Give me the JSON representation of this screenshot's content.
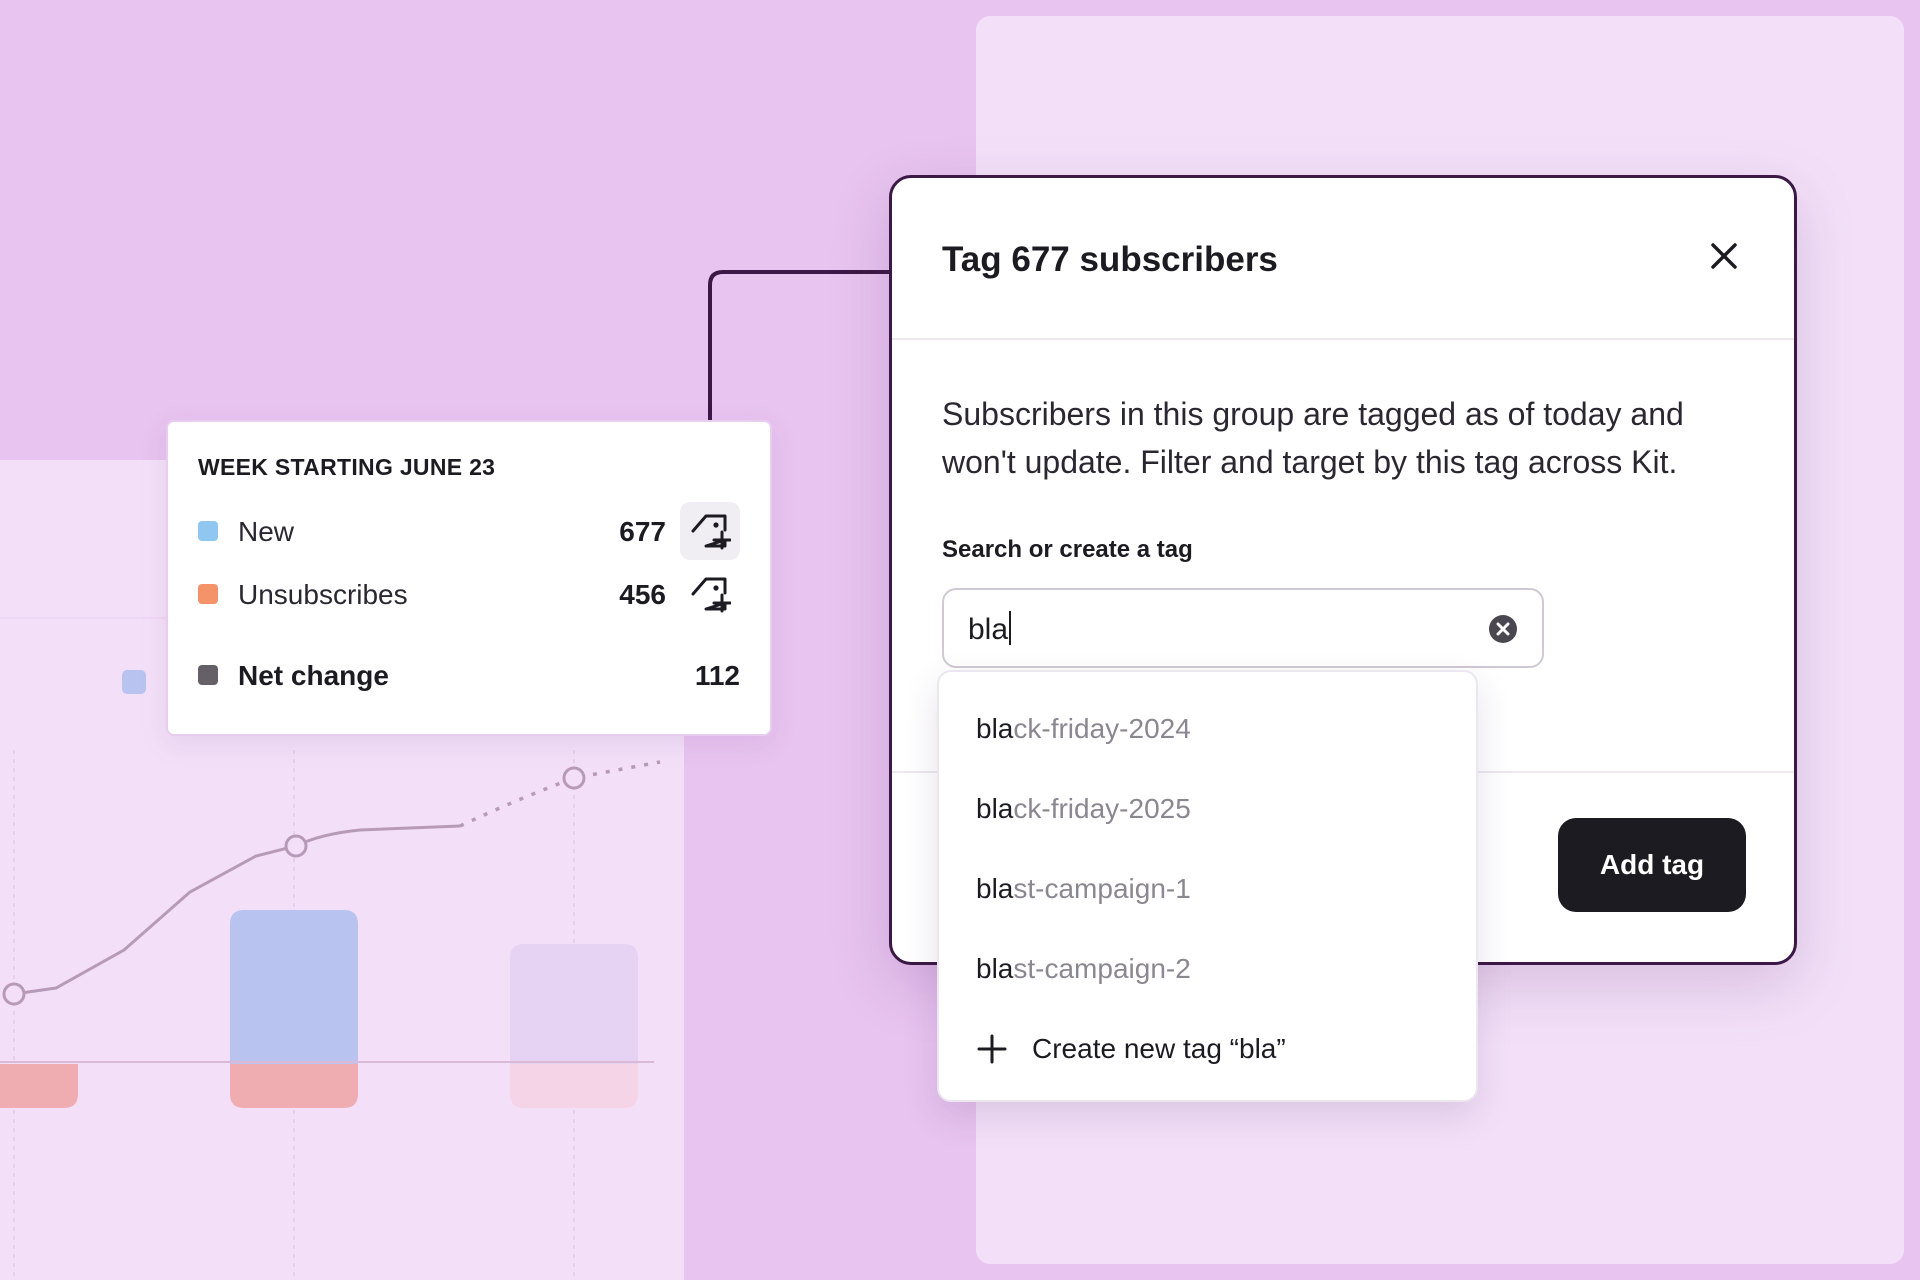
{
  "tooltip": {
    "title": "WEEK STARTING JUNE 23",
    "rows": [
      {
        "label": "New",
        "value": "677",
        "color": "#8fc7f0"
      },
      {
        "label": "Unsubscribes",
        "value": "456",
        "color": "#f4926a"
      },
      {
        "label": "Net change",
        "value": "112",
        "color": "#656068"
      }
    ]
  },
  "modal": {
    "title": "Tag 677 subscribers",
    "description": "Subscribers in this group are tagged as of today and won't update. Filter and target by this tag across Kit.",
    "field_label": "Search or create a tag",
    "search_value": "bla",
    "add_button": "Add tag"
  },
  "dropdown": {
    "match": "bla",
    "options": [
      {
        "match": "bla",
        "rest": "ck-friday-2024"
      },
      {
        "match": "bla",
        "rest": "ck-friday-2025"
      },
      {
        "match": "bla",
        "rest": "st-campaign-1"
      },
      {
        "match": "bla",
        "rest": "st-campaign-2"
      }
    ],
    "create_label": "Create new tag “bla”"
  },
  "colors": {
    "brand_dark": "#1d1b22",
    "modal_border": "#3b1845",
    "page_bg": "#e8c4f0",
    "bar_new": "#b8c4ef",
    "bar_unsub": "#efadb2",
    "line": "#b79ab8"
  },
  "icons": [
    "tag-plus-icon",
    "close-icon",
    "clear-circle-icon",
    "plus-icon"
  ]
}
